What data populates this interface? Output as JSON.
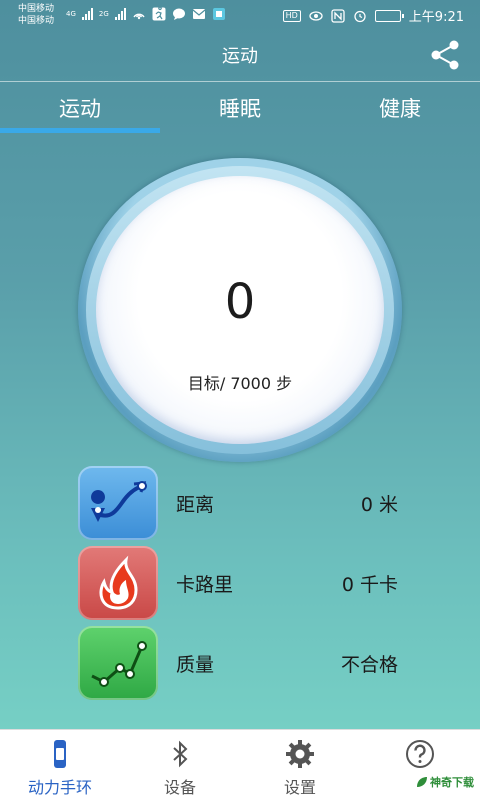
{
  "status_bar": {
    "carrier_1": "中国移动",
    "carrier_2": "中国移动",
    "net_1": "4G",
    "net_2": "2G",
    "hd": "HD",
    "time": "上午9:21"
  },
  "header": {
    "title": "运动",
    "share_icon": "share-icon"
  },
  "tabs": [
    {
      "label": "运动",
      "active": true
    },
    {
      "label": "睡眠",
      "active": false
    },
    {
      "label": "健康",
      "active": false
    }
  ],
  "ring": {
    "steps": "0",
    "goal_text": "目标/ 7000 步"
  },
  "stats": [
    {
      "label": "距离",
      "value": "0 米",
      "icon": "route-icon",
      "color": "#4a9be0"
    },
    {
      "label": "卡路里",
      "value": "0 千卡",
      "icon": "flame-icon",
      "color": "#d65a58"
    },
    {
      "label": "质量",
      "value": "不合格",
      "icon": "trend-chart-icon",
      "color": "#3cbb52"
    }
  ],
  "bottom_nav": [
    {
      "label": "动力手环",
      "icon": "band-icon",
      "active": true
    },
    {
      "label": "设备",
      "icon": "bluetooth-icon",
      "active": false
    },
    {
      "label": "设置",
      "icon": "gear-icon",
      "active": false
    },
    {
      "label": "",
      "icon": "help-icon",
      "active": false
    }
  ],
  "watermark": "神奇下载",
  "colors": {
    "tab_indicator": "#3aa9e8",
    "nav_active": "#2a63c4"
  }
}
